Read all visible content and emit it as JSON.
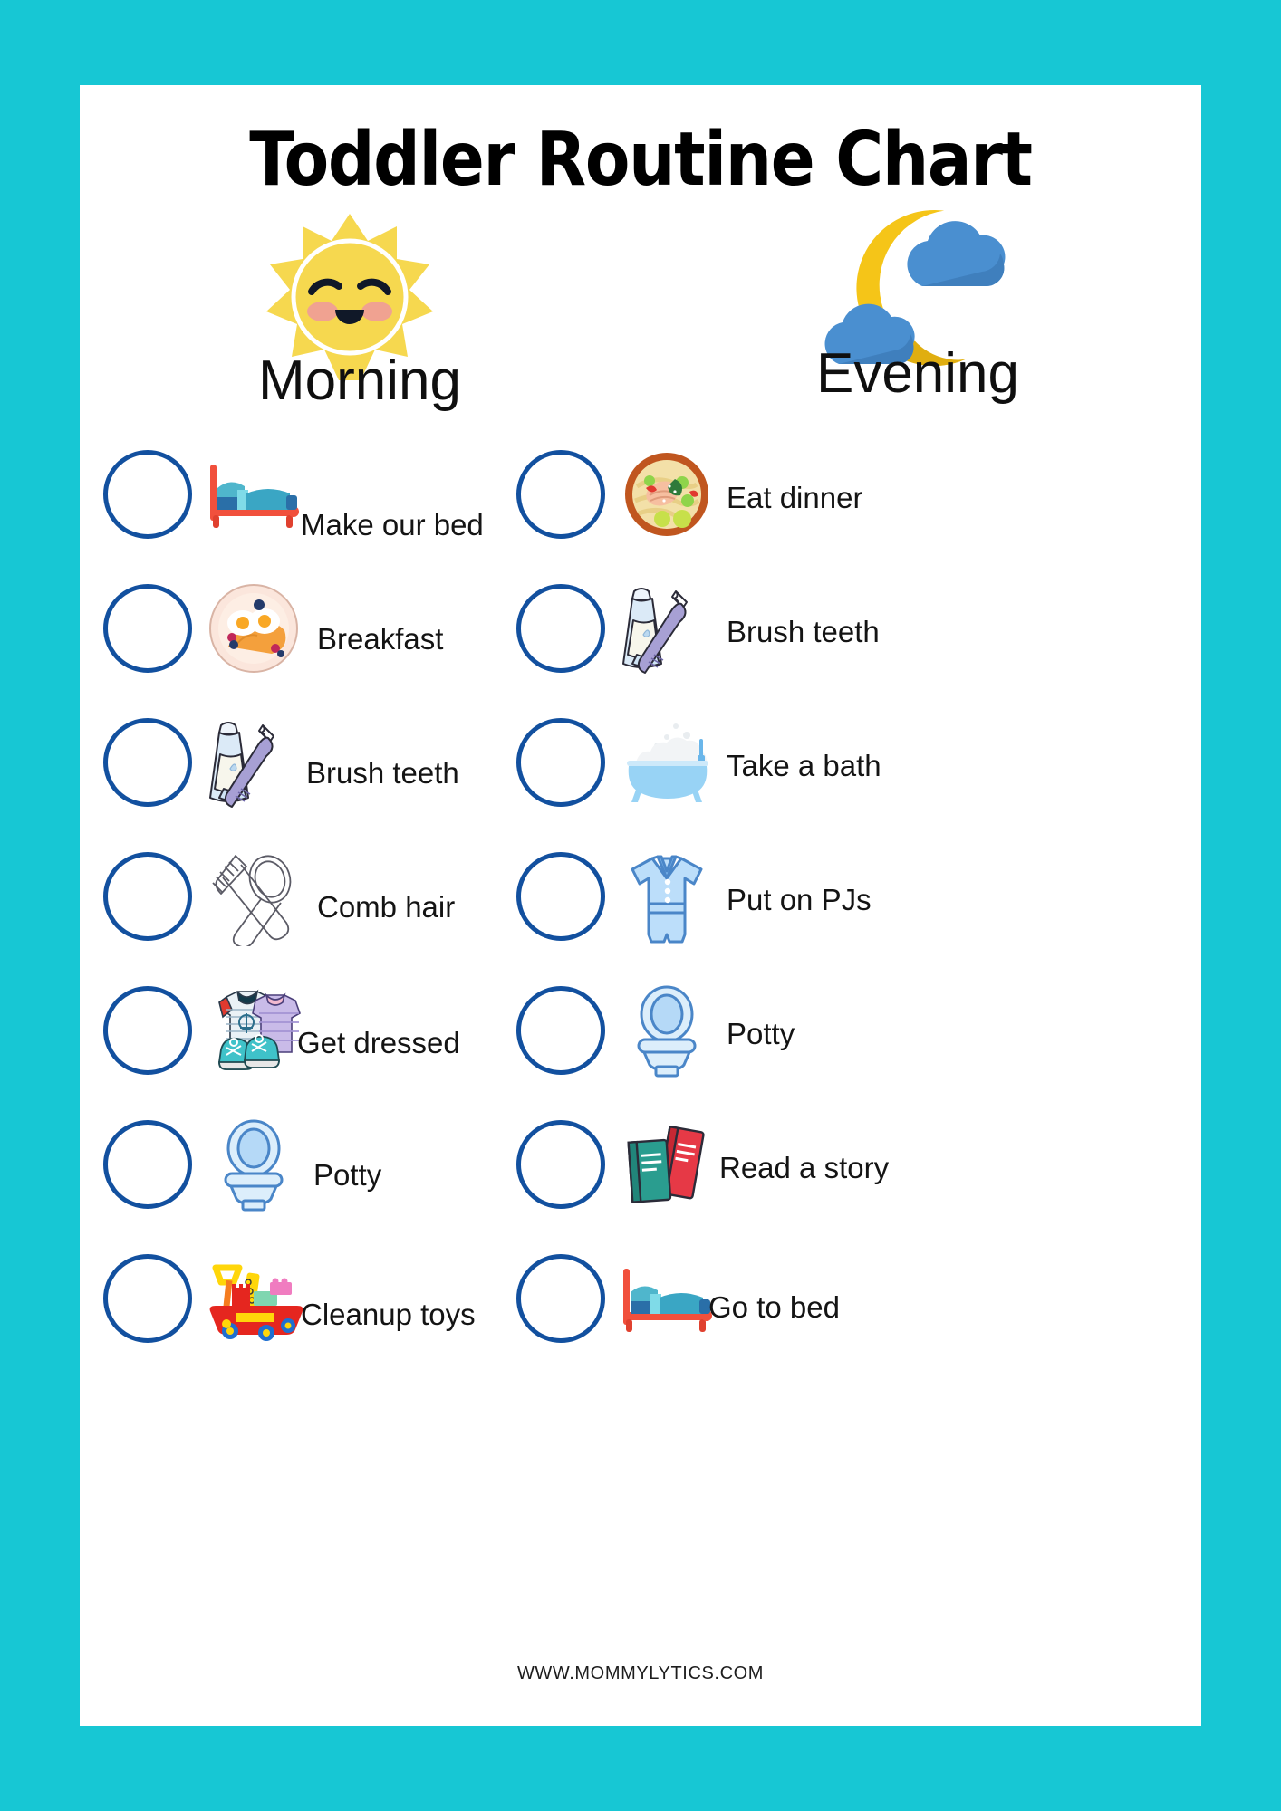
{
  "page": {
    "title": "Toddler Routine Chart",
    "footer": "WWW.MOMMYLYTICS.COM",
    "border_color": "#17c7d4",
    "card_color": "#ffffff",
    "circle_outline_color": "#12509f",
    "title_color": "#000000",
    "label_color": "#141414"
  },
  "sections": [
    {
      "key": "morning",
      "label": "Morning",
      "icon": "sun-smiling-icon",
      "items": [
        {
          "label": "Make our bed",
          "icon": "bed-icon",
          "checked": false
        },
        {
          "label": "Breakfast",
          "icon": "breakfast-plate-icon",
          "checked": false
        },
        {
          "label": "Brush teeth",
          "icon": "toothbrush-icon",
          "checked": false
        },
        {
          "label": "Comb hair",
          "icon": "comb-mirror-icon",
          "checked": false
        },
        {
          "label": "Get dressed",
          "icon": "clothes-shoes-icon",
          "checked": false
        },
        {
          "label": "Potty",
          "icon": "toilet-icon",
          "checked": false
        },
        {
          "label": "Cleanup toys",
          "icon": "toy-wagon-icon",
          "checked": false
        }
      ]
    },
    {
      "key": "evening",
      "label": "Evening",
      "icon": "moon-clouds-icon",
      "items": [
        {
          "label": "Eat dinner",
          "icon": "dinner-bowl-icon",
          "checked": false
        },
        {
          "label": "Brush teeth",
          "icon": "toothbrush-icon",
          "checked": false
        },
        {
          "label": "Take a bath",
          "icon": "bathtub-icon",
          "checked": false
        },
        {
          "label": "Put on PJs",
          "icon": "pajamas-icon",
          "checked": false
        },
        {
          "label": "Potty",
          "icon": "toilet-icon",
          "checked": false
        },
        {
          "label": "Read a story",
          "icon": "books-icon",
          "checked": false
        },
        {
          "label": "Go to bed",
          "icon": "bed-icon",
          "checked": false
        }
      ]
    }
  ],
  "colors": {
    "teal_border": "#17c7d4",
    "circle_blue": "#12509f",
    "sun_yellow": "#f6d84f",
    "moon_yellow": "#f5c518",
    "cloud_blue": "#4a8fd0",
    "bed_red": "#f1503c",
    "bed_blue": "#3aa6c4"
  }
}
